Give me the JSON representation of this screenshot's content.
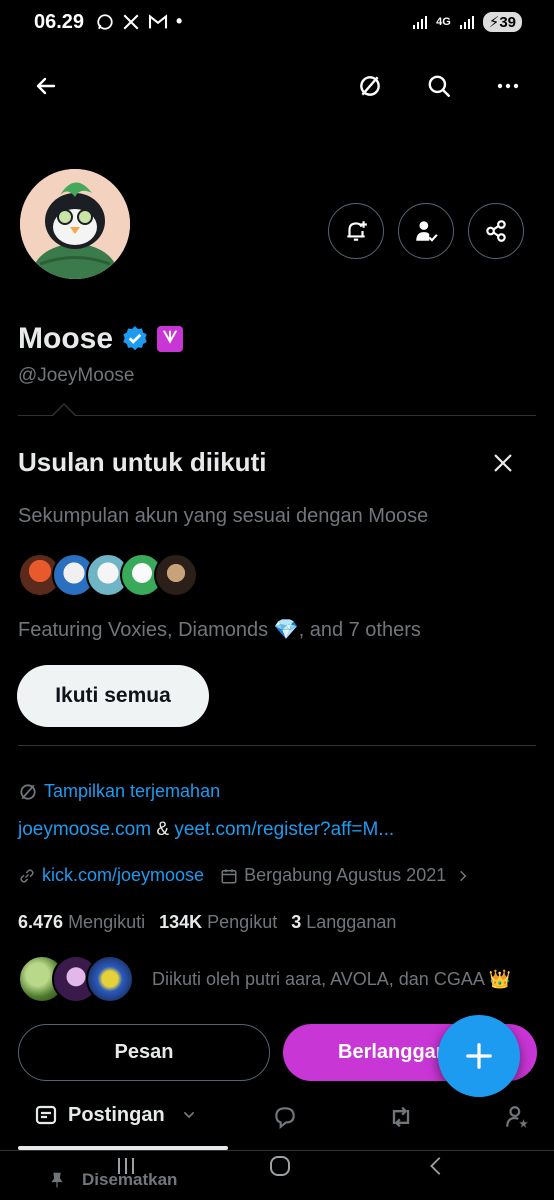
{
  "status_bar": {
    "time": "06.29",
    "battery": "39",
    "network": "4G"
  },
  "profile": {
    "name": "Moose",
    "handle": "@JoeyMoose",
    "badge_glyph": "ᗐ"
  },
  "suggestions": {
    "title": "Usulan untuk diikuti",
    "subtitle": "Sekumpulan akun yang sesuai dengan Moose",
    "featuring": "Featuring Voxies, Diamonds 💎, and 7 others",
    "follow_all_label": "Ikuti semua"
  },
  "bio": {
    "translate_label": "Tampilkan terjemahan",
    "link1": "joeymoose.com",
    "link_separator": "&",
    "link2": "yeet.com/register?aff=M...",
    "link3": "kick.com/joeymoose",
    "joined": "Bergabung Agustus 2021"
  },
  "stats": {
    "following_count": "6.476",
    "following_label": "Mengikuti",
    "followers_count": "134K",
    "followers_label": "Pengikut",
    "subs_count": "3",
    "subs_label": "Langganan"
  },
  "followed_by": "Diikuti oleh putri aara, AVOLA, dan CGAA 👑",
  "actions": {
    "message_label": "Pesan",
    "subscribe_label": "Berlangganan"
  },
  "tabs": {
    "active_label": "Postingan"
  },
  "pinned_label": "Disematkan",
  "colors": {
    "accent_blue": "#1d9bf0",
    "subscribe_purple": "#c936d6",
    "background": "#000000",
    "muted_text": "#71767b"
  }
}
